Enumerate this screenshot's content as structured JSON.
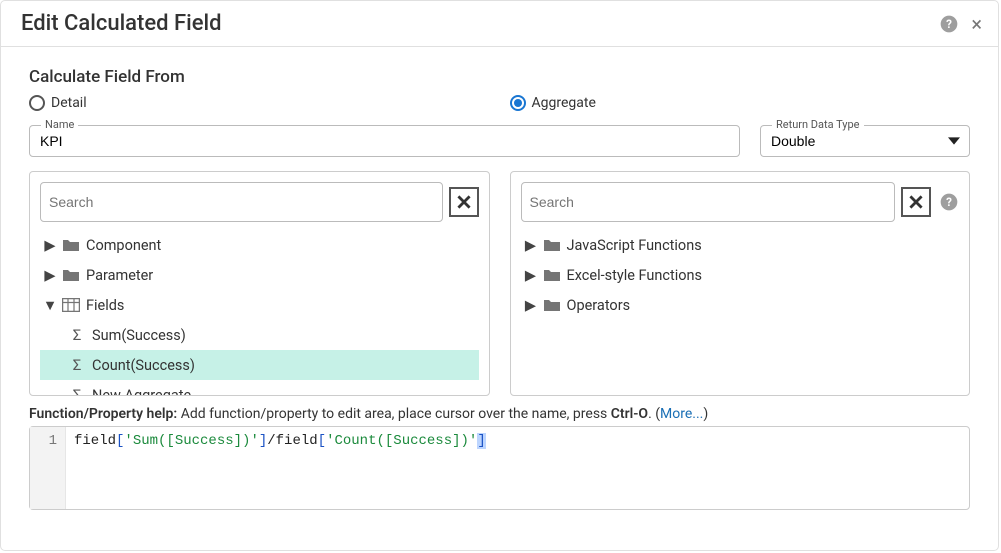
{
  "dialog": {
    "title": "Edit Calculated Field"
  },
  "section_title": "Calculate Field From",
  "radio": {
    "detail": "Detail",
    "aggregate": "Aggregate",
    "selected": "aggregate"
  },
  "name_field": {
    "label": "Name",
    "value": "KPI"
  },
  "return_type": {
    "label": "Return Data Type",
    "value": "Double"
  },
  "left_pane": {
    "search_placeholder": "Search",
    "items": {
      "component": "Component",
      "parameter": "Parameter",
      "fields": "Fields",
      "sum_success": "Sum(Success)",
      "count_success": "Count(Success)",
      "new_aggregate": "New Aggregate"
    }
  },
  "right_pane": {
    "search_placeholder": "Search",
    "items": {
      "js_fn": "JavaScript Functions",
      "excel_fn": "Excel-style Functions",
      "operators": "Operators"
    }
  },
  "hint": {
    "label": "Function/Property help:",
    "text": " Add function/property to edit area, place cursor over the name, press ",
    "key": "Ctrl-O",
    "tail": ". (",
    "more": "More...",
    "end": ")"
  },
  "editor": {
    "line_num": "1",
    "code": {
      "p1": "field",
      "p2": "[",
      "p3": "'Sum([Success])'",
      "p4": "]",
      "p5": "/",
      "p6": "field",
      "p7": "[",
      "p8": "'Count([Success])'",
      "p9": "]"
    }
  }
}
